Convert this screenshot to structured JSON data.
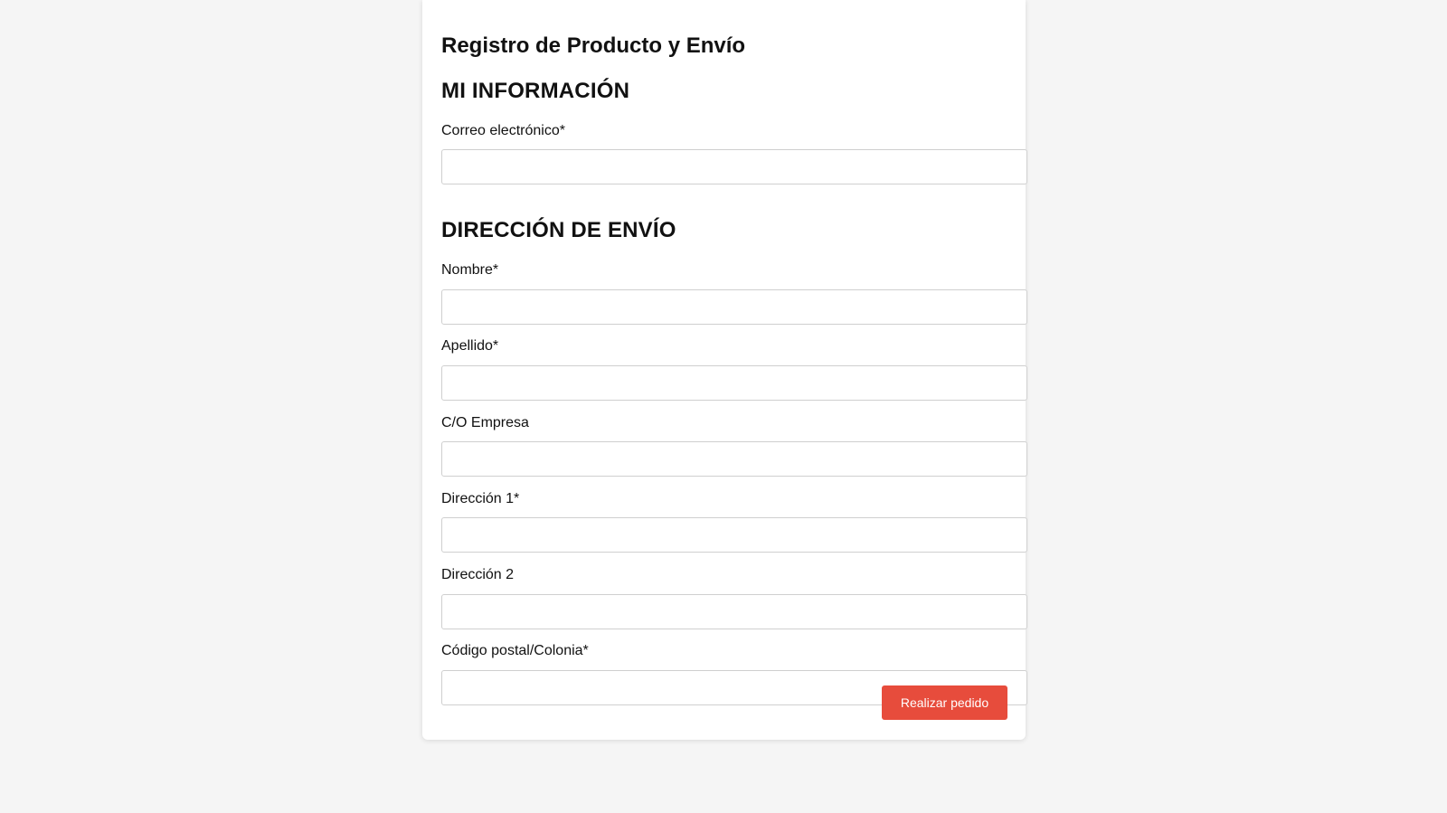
{
  "form": {
    "title": "Registro de Producto y Envío",
    "my_info": {
      "heading": "MI INFORMACIÓN",
      "email_label": "Correo electrónico*",
      "email_value": "",
      "email_placeholder": ""
    },
    "shipping": {
      "heading": "DIRECCIÓN DE ENVÍO",
      "first_name_label": "Nombre*",
      "first_name_value": "",
      "last_name_label": "Apellido*",
      "last_name_value": "",
      "company_label": "C/O Empresa",
      "company_value": "",
      "address1_label": "Dirección 1*",
      "address1_value": "",
      "address2_label": "Dirección 2",
      "address2_value": "",
      "postal_label": "Código postal/Colonia*",
      "postal_value": ""
    },
    "submit_label": "Realizar pedido"
  },
  "colors": {
    "page_background": "#f5f5f5",
    "card_background": "#ffffff",
    "accent_button": "#e74c3c",
    "input_border": "#cfcfcf"
  }
}
